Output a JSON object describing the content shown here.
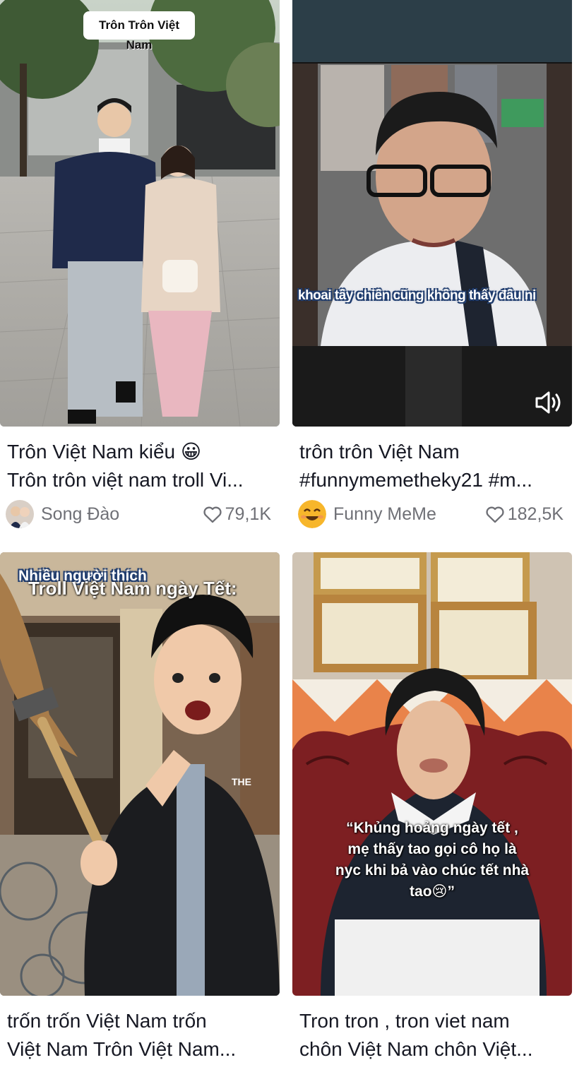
{
  "feed": [
    {
      "overlay": "Trôn Trôn Việt Nam",
      "title_line1": "Trôn Việt Nam kiểu 😀",
      "title_line2": "Trôn trôn việt nam troll Vi...",
      "author": "Song Đào",
      "likes": "79,1K",
      "avatar_icon": "couple-avatar"
    },
    {
      "overlay": "khoai tây chiên cũng không thấy đâu ni",
      "title_line1": "trôn trôn Việt Nam",
      "title_line2": "#funnymemetheky21 #m...",
      "author": "Funny MeMe",
      "likes": "182,5K",
      "avatar_icon": "smiling-emoji-avatar",
      "sound_icon": "speaker-icon"
    },
    {
      "overlay_line1": "Nhiều người thích",
      "overlay_line2": "Troll Việt Nam ngày Tết:",
      "title_line1": "trốn trốn Việt Nam trốn",
      "title_line2": "Việt Nam Trôn Việt Nam..."
    },
    {
      "overlay_line1": "“Khủng hoảng ngày tết ,",
      "overlay_line2": "mẹ thấy tao gọi cô họ là",
      "overlay_line3": "nyc khi bả vào chúc tết nhà",
      "overlay_line4": "tao😢”",
      "title_line1": "Tron tron , tron viet nam",
      "title_line2": "chôn Việt Nam chôn Việt..."
    }
  ],
  "colors": {
    "text": "#161823",
    "meta": "#6f7076",
    "background": "#ffffff"
  },
  "icons": {
    "heart": "heart-outline-icon",
    "sound": "speaker-icon"
  }
}
